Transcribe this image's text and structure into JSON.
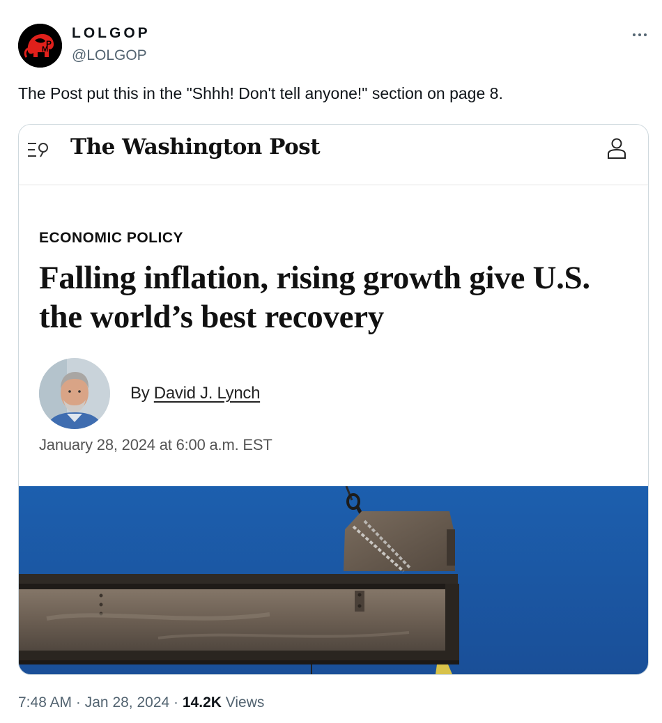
{
  "tweet": {
    "display_name": "LOLGOP",
    "handle": "@LOLGOP",
    "text": "The Post put this in the \"Shhh! Don't tell anyone!\" section on page 8.",
    "time": "7:48 AM",
    "separator": "·",
    "date": "Jan 28, 2024",
    "views_count": "14.2K",
    "views_label": "Views"
  },
  "card": {
    "publication": "The Washington Post",
    "kicker": "ECONOMIC POLICY",
    "headline": "Falling inflation, rising growth give U.S. the world’s best recovery",
    "byline_prefix": "By",
    "author": "David J. Lynch",
    "dateline": "January 28, 2024 at 6:00 a.m. EST"
  },
  "icons": {
    "avatar": "gop-elephant-avatar",
    "more": "more-horizontal-icon",
    "menu_search": "menu-search-icon",
    "account": "user-account-icon"
  },
  "colors": {
    "text_primary": "#0f1419",
    "text_secondary": "#536471",
    "border": "#cfd9de",
    "sky_blue": "#1b5aa8",
    "steel_beam": "#6e6258",
    "avatar_red": "#e0201b"
  }
}
